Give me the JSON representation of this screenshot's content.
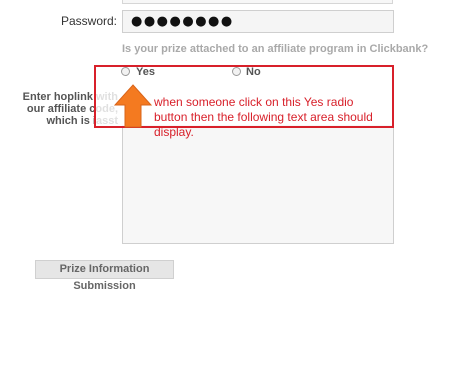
{
  "form": {
    "password_label": "Password:",
    "password_value": "●●●●●●●●",
    "affiliate_question": "Is your prize attached to an affiliate program in Clickbank?",
    "radio_yes_label": "Yes",
    "radio_no_label": "No",
    "hoplink_label": "Enter hoplink with\nour affiliate code,\nwhich is iasst",
    "submit_label": "Prize Information Submission"
  },
  "annotation": {
    "text": "when someone click on this Yes radio button then the following text area should display.",
    "color": "#d8202a",
    "arrow_color": "#f47a20"
  }
}
